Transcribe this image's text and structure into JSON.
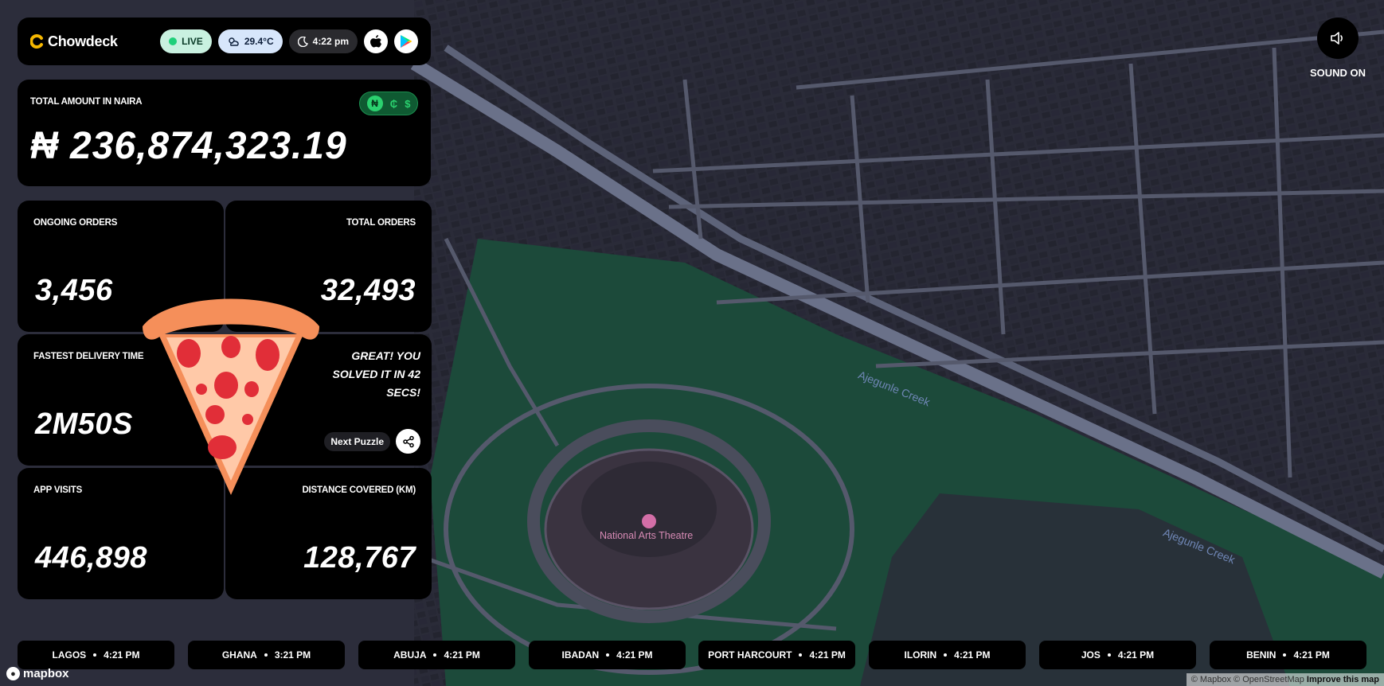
{
  "app": {
    "brand": "Chowdeck",
    "live_label": "LIVE",
    "temperature": "29.4°C",
    "time": "4:22 pm",
    "colors": {
      "accent_green": "#2bd16f",
      "brand_yellow": "#f5b700",
      "background": "#000000",
      "park_green": "#1c4a3a"
    }
  },
  "amount": {
    "label": "TOTAL AMOUNT IN NAIRA",
    "value": "₦ 236,874,323.19",
    "currencies": [
      "₦",
      "₵",
      "$"
    ],
    "active_currency": "₦"
  },
  "stats": {
    "ongoing": {
      "label": "ONGOING ORDERS",
      "value": "3,456"
    },
    "total": {
      "label": "TOTAL ORDERS",
      "value": "32,493"
    },
    "fastest": {
      "label": "FASTEST DELIVERY TIME",
      "value": "2M50S"
    },
    "visits": {
      "label": "APP VISITS",
      "value": "446,898"
    },
    "distance": {
      "label": "DISTANCE COVERED (KM)",
      "value": "128,767"
    }
  },
  "puzzle": {
    "message": "GREAT! YOU SOLVED IT IN 42 SECS!",
    "next_label": "Next Puzzle",
    "icon": "pizza-slice-icon"
  },
  "sound": {
    "label": "SOUND ON",
    "icon": "speaker-icon"
  },
  "cities": [
    {
      "name": "LAGOS",
      "time": "4:21 PM"
    },
    {
      "name": "GHANA",
      "time": "3:21 PM"
    },
    {
      "name": "ABUJA",
      "time": "4:21 PM"
    },
    {
      "name": "IBADAN",
      "time": "4:21 PM"
    },
    {
      "name": "PORT HARCOURT",
      "time": "4:21 PM"
    },
    {
      "name": "ILORIN",
      "time": "4:21 PM"
    },
    {
      "name": "JOS",
      "time": "4:21 PM"
    },
    {
      "name": "BENIN",
      "time": "4:21 PM"
    }
  ],
  "map": {
    "landmark": "National Arts Theatre",
    "creek_label_1": "Ajegunle Creek",
    "creek_label_2": "Ajegunle Creek",
    "mapbox_label": "mapbox",
    "attribution_a": "© Mapbox © OpenStreetMap",
    "attribution_b": "Improve this map"
  }
}
